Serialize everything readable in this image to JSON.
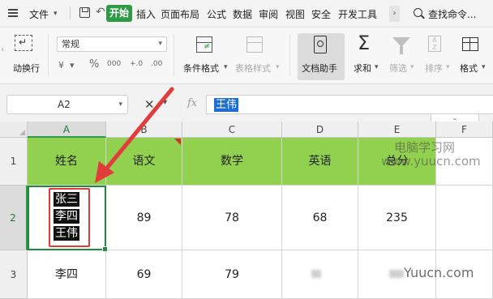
{
  "menu": {
    "file_label": "文件",
    "start_tab": "开始",
    "tabs": [
      "插入",
      "页面布局",
      "公式",
      "数据",
      "审阅",
      "视图",
      "安全",
      "开发工具"
    ],
    "search_placeholder": "查找命令..."
  },
  "ribbon": {
    "wrap_text_label": "动换行",
    "number_format_value": "常规",
    "percent_symbol": "%",
    "thousands_symbol": "000",
    "increase_decimal_symbol": "+.0",
    "decrease_decimal_symbol": ".00",
    "conditional_format_label": "条件格式",
    "table_style_label": "表格样式",
    "doc_helper_label": "文档助手",
    "sum_label": "求和",
    "filter_label": "筛选",
    "sort_label": "排序",
    "format_label": "格式"
  },
  "formula_bar": {
    "cell_ref": "A2",
    "fx_label": "fx",
    "value": "王伟"
  },
  "sheet": {
    "columns": [
      "A",
      "B",
      "C",
      "D",
      "E",
      "F"
    ],
    "rows": [
      "1",
      "2",
      "3"
    ],
    "header_row": [
      "姓名",
      "语文",
      "数学",
      "英语",
      "总分",
      ""
    ],
    "row2": {
      "a_lines": [
        "张三",
        "李四",
        "王伟"
      ],
      "b": "89",
      "c": "78",
      "d": "68",
      "e": "235"
    },
    "row3": {
      "a": "李四",
      "b": "69",
      "c": "79"
    }
  },
  "watermarks": {
    "top_cn": "电脑学习网",
    "top_url": "www.yuucn.com",
    "bottom": "Yuucn.com"
  },
  "colors": {
    "header_fill": "#92d050",
    "selection": "#1e8a3c",
    "annotation": "#e23b3b",
    "start_tab": "#2f9a45",
    "formula_highlight": "#1f6fd1"
  }
}
